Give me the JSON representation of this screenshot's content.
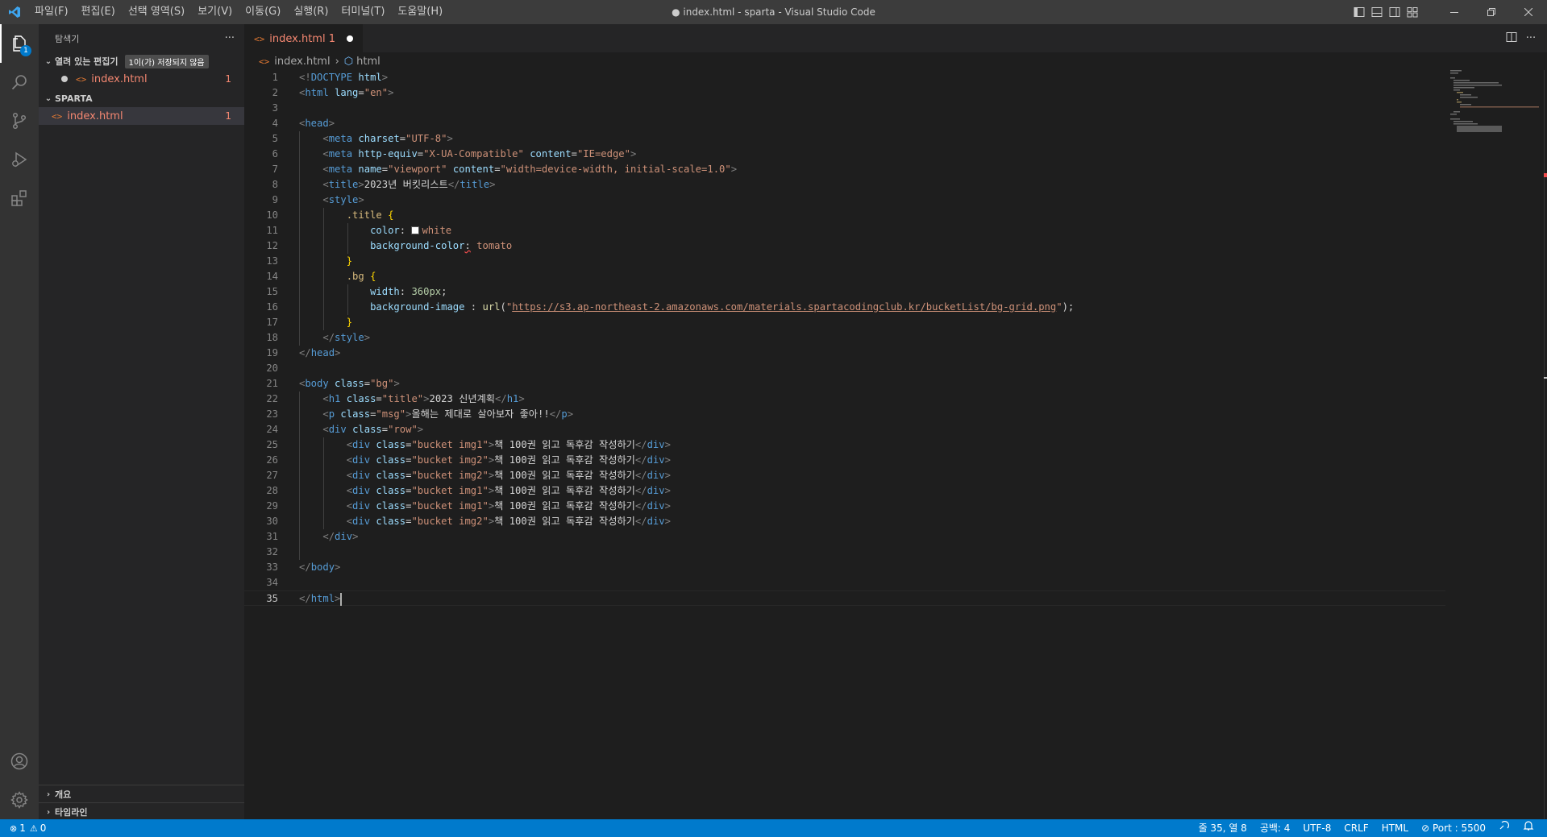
{
  "titlebar": {
    "menus": [
      "파일(F)",
      "편집(E)",
      "선택 영역(S)",
      "보기(V)",
      "이동(G)",
      "실행(R)",
      "터미널(T)",
      "도움말(H)"
    ],
    "window_title": "● index.html - sparta - Visual Studio Code"
  },
  "activitybar": {
    "explorer_badge": "1"
  },
  "sidebar": {
    "title": "탐색기",
    "more": "···",
    "open_editors": {
      "label": "열려 있는 편집기",
      "dirty_badge": "1이(가) 저장되지 않음",
      "files": [
        {
          "name": "index.html",
          "problems": "1"
        }
      ]
    },
    "folder": {
      "label": "SPARTA",
      "files": [
        {
          "name": "index.html",
          "problems": "1"
        }
      ]
    },
    "outline_label": "개요",
    "timeline_label": "타임라인"
  },
  "editor": {
    "tab": {
      "label": "index.html 1"
    },
    "breadcrumb": {
      "file": "index.html",
      "symbol": "html"
    },
    "line_numbers": [
      "1",
      "2",
      "3",
      "4",
      "5",
      "6",
      "7",
      "8",
      "9",
      "10",
      "11",
      "12",
      "13",
      "14",
      "15",
      "16",
      "17",
      "18",
      "19",
      "20",
      "21",
      "22",
      "23",
      "24",
      "25",
      "26",
      "27",
      "28",
      "29",
      "30",
      "31",
      "32",
      "33",
      "34",
      "35"
    ],
    "code": {
      "doctype": "html",
      "html_lang": "\"en\"",
      "meta_charset": "\"UTF-8\"",
      "meta_http_equiv": "\"X-UA-Compatible\"",
      "meta_content_ie": "\"IE=edge\"",
      "meta_name": "\"viewport\"",
      "meta_content_vp": "\"width=device-width, initial-scale=1.0\"",
      "title_text": "2023년 버킷리스트",
      "css_title_selector": ".title",
      "css_color_prop": "color",
      "css_color_value": "white",
      "css_bgcolor_prop": "background-color",
      "css_bgcolor_value": "tomato",
      "css_bg_selector": ".bg",
      "css_width_prop": "width",
      "css_width_value": "360px",
      "css_bgimage_prop": "background-image",
      "css_url_fn": "url",
      "css_url": "https://s3.ap-northeast-2.amazonaws.com/materials.spartacodingclub.kr/bucketList/bg-grid.png",
      "body_class": "\"bg\"",
      "h1_class": "\"title\"",
      "h1_text": "2023 신년계획",
      "p_class": "\"msg\"",
      "p_text": "올해는 제대로 살아보자 좋아!!",
      "row_class": "\"row\"",
      "bucket_rows": [
        {
          "class": "\"bucket img1\"",
          "text": "책 100권 읽고 독후감 작성하기"
        },
        {
          "class": "\"bucket img2\"",
          "text": "책 100권 읽고 독후감 작성하기"
        },
        {
          "class": "\"bucket img2\"",
          "text": "책 100권 읽고 독후감 작성하기"
        },
        {
          "class": "\"bucket img1\"",
          "text": "책 100권 읽고 독후감 작성하기"
        },
        {
          "class": "\"bucket img1\"",
          "text": "책 100권 읽고 독후감 작성하기"
        },
        {
          "class": "\"bucket img2\"",
          "text": "책 100권 읽고 독후감 작성하기"
        }
      ]
    }
  },
  "statusbar": {
    "errors": "1",
    "warnings": "0",
    "cursor_position": "줄 35, 열 8",
    "indent": "공백: 4",
    "encoding": "UTF-8",
    "eol": "CRLF",
    "language": "HTML",
    "port": "Port : 5500"
  },
  "colors": {
    "accent": "#007acc",
    "error_file": "#f48771",
    "html_icon": "#e37933"
  }
}
